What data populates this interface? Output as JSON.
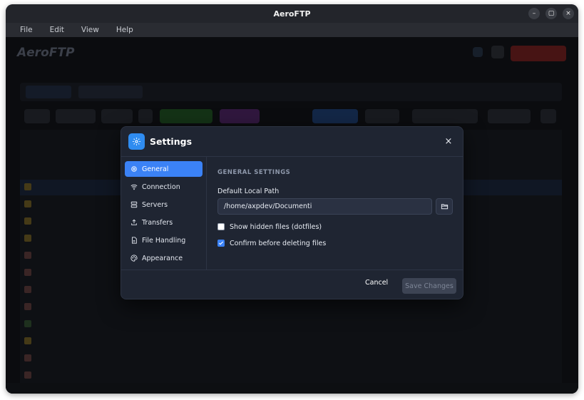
{
  "window": {
    "title": "AeroFTP"
  },
  "window_controls": {
    "minimize": "–",
    "maximize": "▢",
    "close": "×"
  },
  "menu": [
    "File",
    "Edit",
    "View",
    "Help"
  ],
  "background_app": {
    "logo": "AeroFTP",
    "dimmed": true
  },
  "settings": {
    "title": "Settings",
    "close_label": "×",
    "nav": [
      {
        "label": "General",
        "icon": "gear-icon",
        "active": true
      },
      {
        "label": "Connection",
        "icon": "wifi-icon",
        "active": false
      },
      {
        "label": "Servers",
        "icon": "server-icon",
        "active": false
      },
      {
        "label": "Transfers",
        "icon": "upload-icon",
        "active": false
      },
      {
        "label": "File Handling",
        "icon": "file-icon",
        "active": false
      },
      {
        "label": "Appearance",
        "icon": "palette-icon",
        "active": false
      }
    ],
    "section_title": "GENERAL SETTINGS",
    "default_local_path_label": "Default Local Path",
    "default_local_path_value": "/home/axpdev/Documenti",
    "show_hidden": {
      "label": "Show hidden files (dotfiles)",
      "checked": false
    },
    "confirm_delete": {
      "label": "Confirm before deleting files",
      "checked": true
    },
    "cancel_label": "Cancel",
    "save_label": "Save Changes"
  },
  "colors": {
    "accent": "#3b82f6",
    "modal_bg": "#1f2532",
    "app_bg": "#111318"
  }
}
